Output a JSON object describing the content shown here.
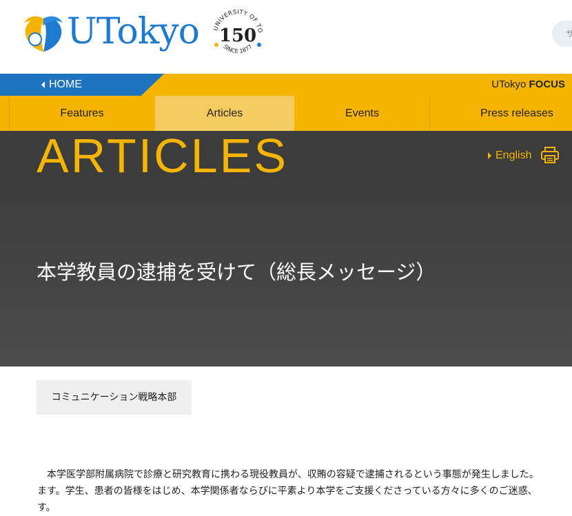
{
  "header": {
    "logo_text": "UTokyo",
    "badge": {
      "number": "150",
      "arc_top": "THE UNIVERSITY OF TOKYO",
      "arc_bottom": "SINCE 1877"
    },
    "search_placeholder": "サ"
  },
  "topbar": {
    "home_label": "HOME",
    "focus_prefix": "UTokyo",
    "focus_bold": "FOCUS"
  },
  "nav": {
    "items": [
      {
        "label": "Features"
      },
      {
        "label": "Articles",
        "active": true
      },
      {
        "label": "Events"
      },
      {
        "label": "Press releases"
      }
    ]
  },
  "section": {
    "title": "ARTICLES",
    "language_label": "English"
  },
  "article": {
    "title": "本学教員の逮捕を受けて（総長メッセージ）",
    "author": "コミュニケーション戦略本部",
    "paragraph_lines": [
      "　本学医学部附属病院で診療と研究教育に携わる現役教員が、収賄の容疑で逮捕されるという事態が発生しました。",
      "ます。学生、患者の皆様をはじめ、本学関係者ならびに平素より本学をご支援くださっている方々に多くのご迷惑、",
      "す。"
    ]
  },
  "colors": {
    "brand_blue": "#1e73be",
    "brand_yellow": "#f5b400",
    "dark_band": "#3c3c3c"
  },
  "icons": {
    "logo": "ginkgo-leaf-icon",
    "print": "printer-icon",
    "home_arrow": "triangle-left-icon",
    "language_arrow": "triangle-right-icon"
  }
}
